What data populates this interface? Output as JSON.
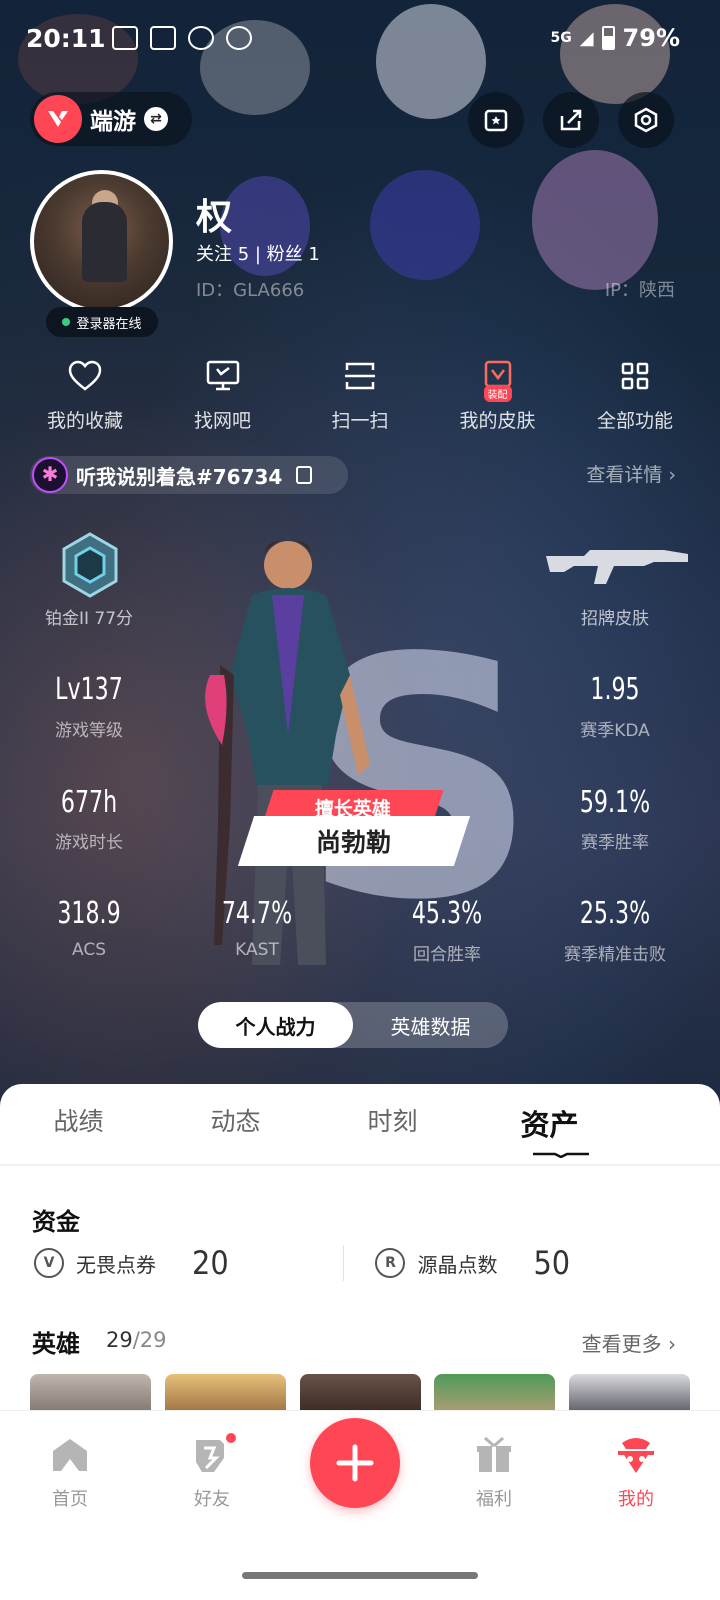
{
  "status_bar": {
    "time": "20:11",
    "network": "5G",
    "battery": "79%"
  },
  "header": {
    "game_label": "端游"
  },
  "profile": {
    "name": "权",
    "follow_text": "关注 5  |  粉丝 1",
    "id_text": "ID：GLA666",
    "ip_text": "IP：陕西",
    "online_status": "登录器在线"
  },
  "functions": [
    {
      "label": "我的收藏",
      "icon": "heart-icon"
    },
    {
      "label": "找网吧",
      "icon": "monitor-icon"
    },
    {
      "label": "扫一扫",
      "icon": "scan-icon"
    },
    {
      "label": "我的皮肤",
      "icon": "skin-icon",
      "tag": "装配"
    },
    {
      "label": "全部功能",
      "icon": "grid-icon"
    }
  ],
  "player": {
    "name": "听我说别着急#76734",
    "detail_link": "查看详情 ›"
  },
  "stats": {
    "rank": "铂金II 77分",
    "skin": "招牌皮肤",
    "level": {
      "value": "Lv137",
      "label": "游戏等级"
    },
    "kda": {
      "value": "1.95",
      "label": "赛季KDA"
    },
    "playtime": {
      "value": "677h",
      "label": "游戏时长"
    },
    "winrate": {
      "value": "59.1%",
      "label": "赛季胜率"
    },
    "acs": {
      "value": "318.9",
      "label": "ACS"
    },
    "kast": {
      "value": "74.7%",
      "label": "KAST"
    },
    "round_win": {
      "value": "45.3%",
      "label": "回合胜率"
    },
    "precision": {
      "value": "25.3%",
      "label": "赛季精准击败"
    }
  },
  "best_agent": {
    "tag": "擅长英雄",
    "name": "尚勃勒"
  },
  "toggle": {
    "left": "个人战力",
    "right": "英雄数据"
  },
  "tabs": [
    "战绩",
    "动态",
    "时刻",
    "资产"
  ],
  "assets": {
    "funds_title": "资金",
    "funds": [
      {
        "name": "无畏点券",
        "value": "20",
        "icon": "V"
      },
      {
        "name": "源晶点数",
        "value": "50",
        "icon": "R"
      }
    ],
    "heroes_title": "英雄",
    "heroes_count": "29",
    "heroes_total": "/29",
    "see_more": "查看更多 ›"
  },
  "bottom_nav": [
    {
      "label": "首页",
      "icon": "home-icon"
    },
    {
      "label": "好友",
      "icon": "friends-icon"
    },
    {
      "label": "福利",
      "icon": "gift-icon"
    },
    {
      "label": "我的",
      "icon": "profile-icon"
    }
  ],
  "colors": {
    "accent": "#ff4655",
    "online": "#35d07f"
  }
}
